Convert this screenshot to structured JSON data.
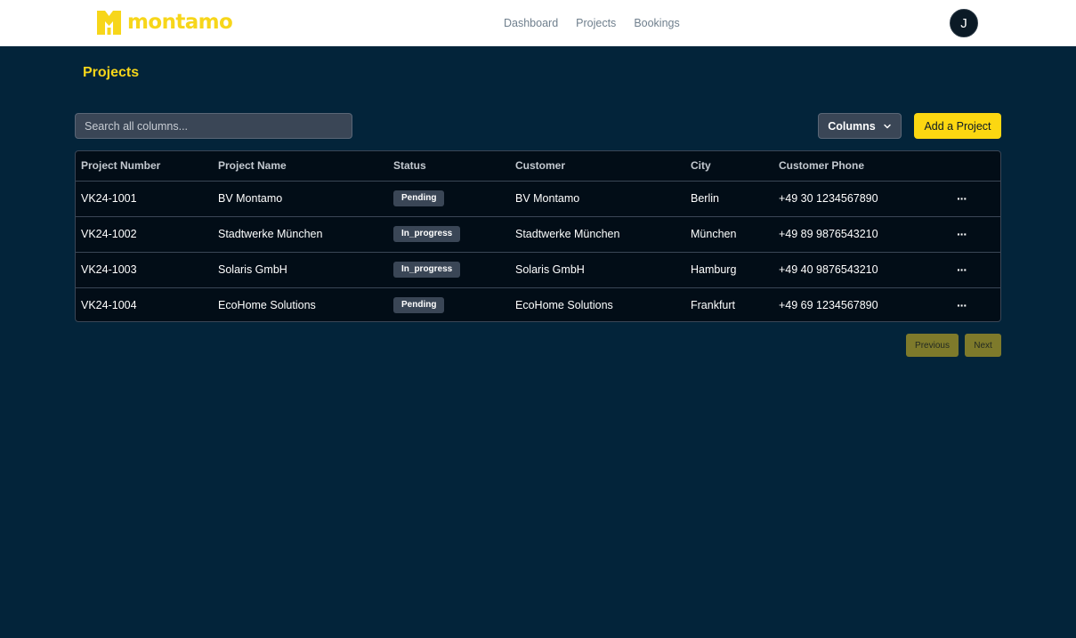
{
  "brand": {
    "name": "montamo",
    "color": "#f7d61a"
  },
  "nav": [
    {
      "label": "Dashboard"
    },
    {
      "label": "Projects"
    },
    {
      "label": "Bookings"
    }
  ],
  "user": {
    "initial": "J"
  },
  "page": {
    "title": "Projects"
  },
  "toolbar": {
    "search_placeholder": "Search all columns...",
    "columns_label": "Columns",
    "columns_icon": "chevron-down-icon",
    "add_label": "Add a Project"
  },
  "table": {
    "headers": [
      "Project Number",
      "Project Name",
      "Status",
      "Customer",
      "City",
      "Customer Phone",
      ""
    ],
    "rows": [
      {
        "number": "VK24-1001",
        "name": "BV Montamo",
        "status": "Pending",
        "customer": "BV Montamo",
        "city": "Berlin",
        "phone": "+49 30 1234567890"
      },
      {
        "number": "VK24-1002",
        "name": "Stadtwerke München",
        "status": "In_progress",
        "customer": "Stadtwerke München",
        "city": "München",
        "phone": "+49 89 9876543210"
      },
      {
        "number": "VK24-1003",
        "name": "Solaris GmbH",
        "status": "In_progress",
        "customer": "Solaris GmbH",
        "city": "Hamburg",
        "phone": "+49 40 9876543210"
      },
      {
        "number": "VK24-1004",
        "name": "EcoHome Solutions",
        "status": "Pending",
        "customer": "EcoHome Solutions",
        "city": "Frankfurt",
        "phone": "+49 69 1234567890"
      }
    ],
    "row_menu_label": "···"
  },
  "pagination": {
    "previous_label": "Previous",
    "next_label": "Next"
  },
  "colors": {
    "background": "#03243a",
    "accent": "#fcd711",
    "table_bg": "#020d17",
    "badge_bg": "#3a4656"
  }
}
